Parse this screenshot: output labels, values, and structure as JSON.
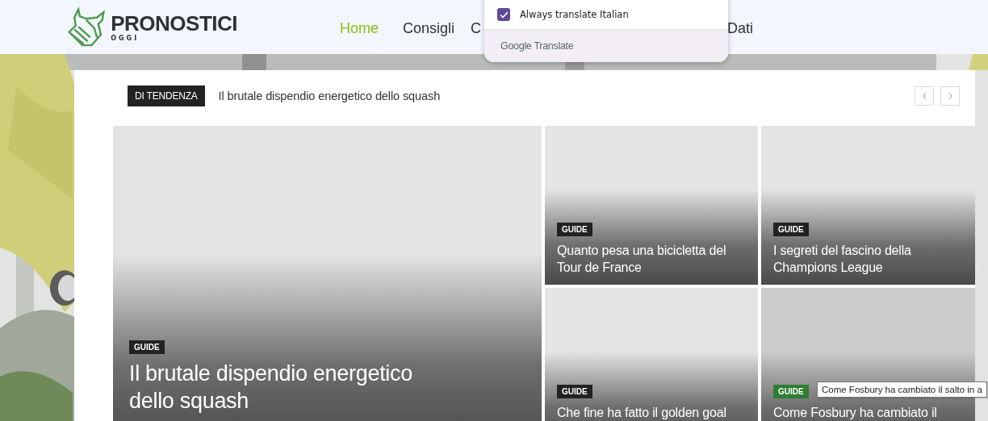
{
  "header": {
    "logo": {
      "title": "PRONOSTICI",
      "subtitle": "OGGI"
    },
    "nav": [
      {
        "label": "Home",
        "selected": true
      },
      {
        "label": "Consigli",
        "selected": false
      },
      {
        "label": "C",
        "selected": false
      },
      {
        "label": "Dati",
        "selected": false
      }
    ]
  },
  "translate_popup": {
    "option": {
      "label": "Always translate Italian",
      "checked": true
    },
    "footer": "Google Translate"
  },
  "trending": {
    "label": "DI TENDENZA",
    "headline": "Il brutale dispendio energetico dello squash"
  },
  "cards": [
    {
      "badge": "GUIDE",
      "color": "#222222",
      "title": "Il brutale dispendio energetico\ndello squash"
    },
    {
      "badge": "GUIDE",
      "color": "#222222",
      "title": "Quanto pesa una bicicletta del\nTour de France"
    },
    {
      "badge": "GUIDE",
      "color": "#222222",
      "title": "I segreti del fascino della\nChampions League"
    },
    {
      "badge": "GUIDE",
      "color": "#222222",
      "title": "Che fine ha fatto il golden goal"
    },
    {
      "badge": "GUIDE",
      "color": "#2e7d32",
      "title": "Come Fosbury ha cambiato il"
    }
  ],
  "tooltip": "Come Fosbury ha cambiato il salto in a"
}
